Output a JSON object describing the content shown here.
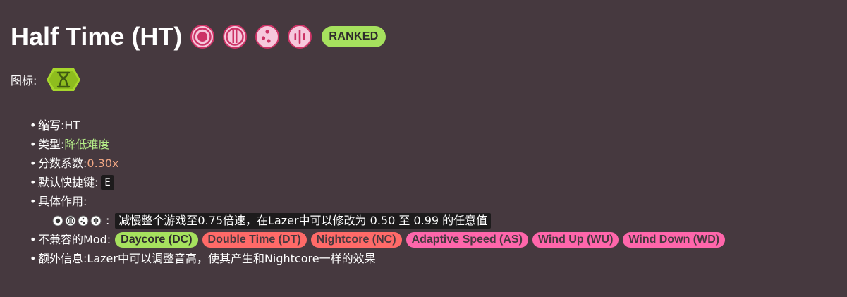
{
  "title": "Half Time (HT)",
  "status_badge": "RANKED",
  "mode_icons": [
    "osu-standard-icon",
    "taiko-icon",
    "catch-icon",
    "mania-icon"
  ],
  "icon_label": "图标:",
  "info": {
    "abbrev_label": "缩写: ",
    "abbrev_value": "HT",
    "type_label": "类型: ",
    "type_value": "降低难度",
    "multiplier_label": "分数系数: ",
    "multiplier_value": "0.30x",
    "hotkey_label": "默认快捷键: ",
    "hotkey_value": "E",
    "effect_label": "具体作用:",
    "effect_sep": ":",
    "effect_text": "减慢整个游戏至0.75倍速，在Lazer中可以修改为 0.50 至 0.99 的任意值",
    "incompat_label": "不兼容的Mod: ",
    "incompat_mods": [
      {
        "label": "Daycore (DC)",
        "color": "#a6e15e"
      },
      {
        "label": "Double Time (DT)",
        "color": "#ff6a68"
      },
      {
        "label": "Nightcore (NC)",
        "color": "#ff6a68"
      },
      {
        "label": "Adaptive Speed (AS)",
        "color": "#ff66ab"
      },
      {
        "label": "Wind Up (WU)",
        "color": "#ff66ab"
      },
      {
        "label": "Wind Down (WD)",
        "color": "#ff66ab"
      }
    ],
    "extra_label": "额外信息: ",
    "extra_value": "Lazer中可以调整音高，使其产生和Nightcore一样的效果"
  },
  "colors": {
    "background": "#46393f",
    "mode_icon_fill": "#f6c8dc",
    "mode_icon_stroke": "#cc3366",
    "ranked_badge": "#a6e15e",
    "mod_icon_fill": "#a6d62c"
  }
}
